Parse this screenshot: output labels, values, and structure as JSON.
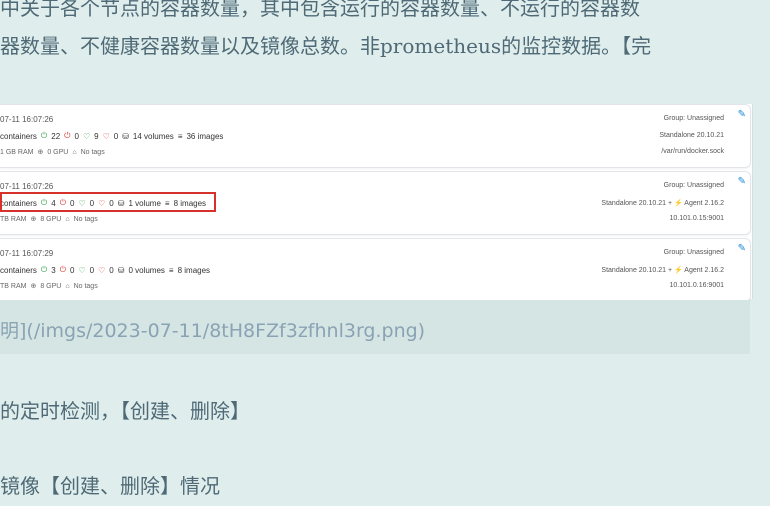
{
  "paragraph": {
    "line1": "中关于各个节点的容器数量，其中包含运行的容器数量、不运行的容器数",
    "line2": "器数量、不健康容器数量以及镜像总数。非prometheus的监控数据。【完"
  },
  "screenshot": {
    "cards": [
      {
        "timestamp": "07-11 16:07:26",
        "containers_label": "containers",
        "running": "22",
        "stopped": "0",
        "healthy": "9",
        "unhealthy": "0",
        "volumes": "14 volumes",
        "images": "36 images",
        "ram": "1 GB RAM",
        "gpu": "0 GPU",
        "tags": "No tags",
        "group": "Group: Unassigned",
        "line2": "Standalone 20.10.21",
        "line3": "/var/run/docker.sock"
      },
      {
        "timestamp": "07-11 16:07:26",
        "containers_label": "containers",
        "running": "4",
        "stopped": "0",
        "healthy": "0",
        "unhealthy": "0",
        "volumes": "1 volume",
        "images": "8 images",
        "ram": "TB RAM",
        "gpu": "8 GPU",
        "tags": "No tags",
        "group": "Group: Unassigned",
        "line2": "Standalone 20.10.21    + ⚡ Agent 2.16.2",
        "line3": "10.101.0.15:9001"
      },
      {
        "timestamp": "07-11 16:07:29",
        "containers_label": "containers",
        "running": "3",
        "stopped": "0",
        "healthy": "0",
        "unhealthy": "0",
        "volumes": "0 volumes",
        "images": "8 images",
        "ram": "TB RAM",
        "gpu": "8 GPU",
        "tags": "No tags",
        "group": "Group: Unassigned",
        "line2": "Standalone 20.10.21    + ⚡ Agent 2.16.2",
        "line3": "10.101.0.16:9001"
      }
    ],
    "icons": {
      "running": "⏻",
      "stopped": "⏻",
      "healthy": "♡",
      "unhealthy": "♡",
      "volume": "⛁",
      "images": "≡",
      "gpu": "⊕",
      "tag": "⌂",
      "edit": "✎"
    }
  },
  "link": {
    "text": "明](/imgs/2023-07-11/8tH8FZf3zfhnl3rg.png)"
  },
  "list": {
    "item1": "的定时检测，【创建、删除】",
    "item2": "镜像【创建、删除】情况"
  }
}
